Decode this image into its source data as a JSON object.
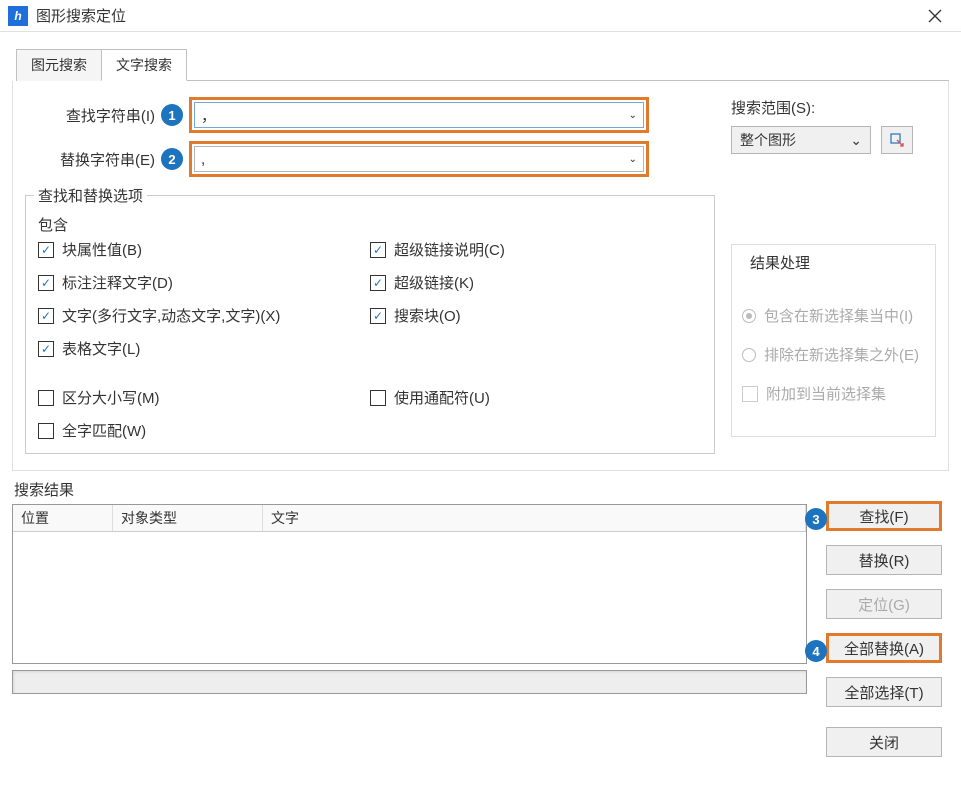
{
  "titlebar": {
    "title": "图形搜索定位"
  },
  "tabs": {
    "primitive": "图元搜索",
    "text": "文字搜索"
  },
  "form": {
    "find_label": "查找字符串(I)",
    "replace_label": "替换字符串(E)",
    "find_value": "，",
    "replace_value": ",",
    "badge1": "1",
    "badge2": "2"
  },
  "options": {
    "group_title": "查找和替换选项",
    "contain_title": "包含",
    "block_attr": "块属性值(B)",
    "dim_text": "标注注释文字(D)",
    "text_types": "文字(多行文字,动态文字,文字)(X)",
    "table_text": "表格文字(L)",
    "hyperlink_desc": "超级链接说明(C)",
    "hyperlink": "超级链接(K)",
    "search_block": "搜索块(O)",
    "case_sensitive": "区分大小写(M)",
    "whole_word": "全字匹配(W)",
    "wildcard": "使用通配符(U)"
  },
  "scope": {
    "label": "搜索范围(S):",
    "value": "整个图形"
  },
  "result_proc": {
    "title": "结果处理",
    "include": "包含在新选择集当中(I)",
    "exclude": "排除在新选择集之外(E)",
    "append": "附加到当前选择集"
  },
  "results": {
    "label": "搜索结果",
    "col1": "位置",
    "col2": "对象类型",
    "col3": "文字"
  },
  "buttons": {
    "find": "查找(F)",
    "replace": "替换(R)",
    "locate": "定位(G)",
    "replace_all": "全部替换(A)",
    "select_all": "全部选择(T)",
    "close": "关闭",
    "badge3": "3",
    "badge4": "4"
  }
}
